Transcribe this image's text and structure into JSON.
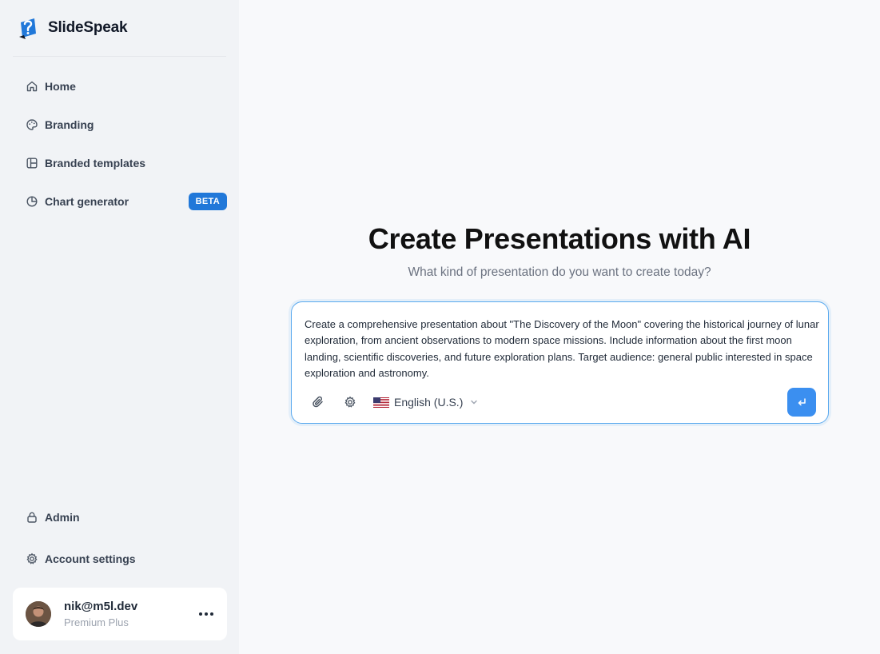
{
  "app": {
    "name": "SlideSpeak"
  },
  "sidebar": {
    "items": [
      {
        "label": "Home",
        "icon": "home-icon"
      },
      {
        "label": "Branding",
        "icon": "palette-icon"
      },
      {
        "label": "Branded templates",
        "icon": "layout-icon"
      },
      {
        "label": "Chart generator",
        "icon": "pie-chart-icon",
        "badge": "BETA"
      }
    ],
    "bottom_items": [
      {
        "label": "Admin",
        "icon": "lock-icon"
      },
      {
        "label": "Account settings",
        "icon": "gear-icon"
      }
    ]
  },
  "user": {
    "email": "nik@m5l.dev",
    "plan": "Premium Plus"
  },
  "main": {
    "title": "Create Presentations with AI",
    "subtitle": "What kind of presentation do you want to create today?",
    "prompt": {
      "value": "Create a comprehensive presentation about \"The Discovery of the Moon\" covering the historical journey of lunar exploration, from ancient observations to modern space missions. Include information about the first moon landing, scientific discoveries, and future exploration plans. Target audience: general public interested in space exploration and astronomy.",
      "language": "English (U.S.)"
    }
  },
  "colors": {
    "accent": "#3b8ff0",
    "badge": "#2178d9",
    "sidebar_bg": "#f1f3f6"
  }
}
